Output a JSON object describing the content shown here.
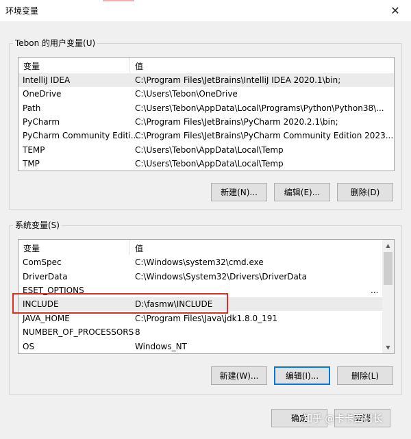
{
  "window": {
    "title": "环境变量",
    "close_icon": "✕"
  },
  "user_vars": {
    "group_label": "Tebon 的用户变量(U)",
    "col_var": "变量",
    "col_value": "值",
    "rows": [
      {
        "name": "IntelliJ IDEA",
        "value": "C:\\Program Files\\JetBrains\\IntelliJ IDEA 2020.1\\bin;"
      },
      {
        "name": "OneDrive",
        "value": "C:\\Users\\Tebon\\OneDrive"
      },
      {
        "name": "Path",
        "value": "C:\\Users\\Tebon\\AppData\\Local\\Programs\\Python\\Python38\\..."
      },
      {
        "name": "PyCharm",
        "value": "C:\\Program Files\\JetBrains\\PyCharm 2020.2.1\\bin;"
      },
      {
        "name": "PyCharm Community Editi...",
        "value": "C:\\Program Files\\JetBrains\\PyCharm Community Edition 2023...."
      },
      {
        "name": "TEMP",
        "value": "C:\\Users\\Tebon\\AppData\\Local\\Temp"
      },
      {
        "name": "TMP",
        "value": "C:\\Users\\Tebon\\AppData\\Local\\Temp"
      }
    ],
    "buttons": {
      "new": "新建(N)...",
      "edit": "编辑(E)...",
      "delete": "删除(D)"
    }
  },
  "system_vars": {
    "group_label": "系统变量(S)",
    "col_var": "变量",
    "col_value": "值",
    "rows": [
      {
        "name": "ComSpec",
        "value": "C:\\Windows\\system32\\cmd.exe"
      },
      {
        "name": "DriverData",
        "value": "C:\\Windows\\System32\\Drivers\\DriverData"
      },
      {
        "name": "ESET_OPTIONS",
        "value": "..."
      },
      {
        "name": "INCLUDE",
        "value": "D:\\fasmw\\INCLUDE"
      },
      {
        "name": "JAVA_HOME",
        "value": "C:\\Program Files\\Java\\jdk1.8.0_191"
      },
      {
        "name": "NUMBER_OF_PROCESSORS",
        "value": "8"
      },
      {
        "name": "OS",
        "value": "Windows_NT"
      }
    ],
    "buttons": {
      "new": "新建(W)...",
      "edit": "编辑(I)...",
      "delete": "删除(L)"
    },
    "scroll_up_icon": "▲",
    "scroll_down_icon": "▼"
  },
  "footer": {
    "ok": "确定",
    "cancel": "取消"
  },
  "watermark": "知乎 @卡卡西村长",
  "colors": {
    "highlight": "#d93025",
    "focus": "#0078d7",
    "selected_row": "#ebebeb"
  }
}
